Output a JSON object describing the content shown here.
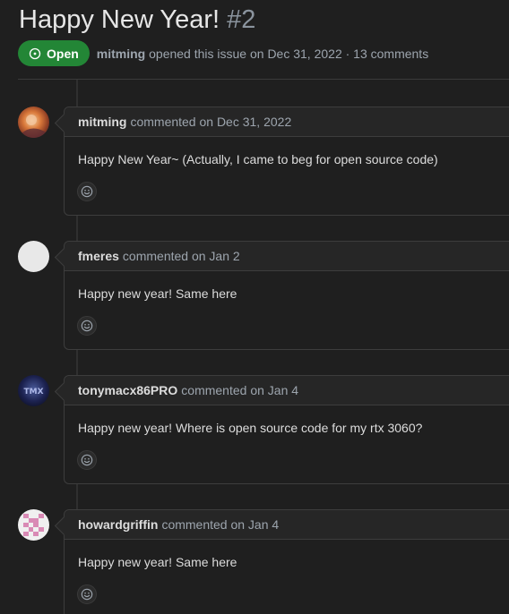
{
  "issue": {
    "title": "Happy New Year!",
    "number": "#2",
    "state": "Open",
    "author": "mitming",
    "opened_text": "opened this issue on Dec 31, 2022 · 13 comments",
    "colors": {
      "open_badge": "#238636"
    }
  },
  "comments": [
    {
      "author": "mitming",
      "action": "commented on Dec 31, 2022",
      "body": "Happy New Year~ (Actually, I came to beg for open source code)",
      "avatar": "orange-portrait-avatar"
    },
    {
      "author": "fmeres",
      "action": "commented on Jan 2",
      "body": "Happy new year! Same here",
      "avatar": "blank-white-avatar"
    },
    {
      "author": "tonymacx86PRO",
      "action": "commented on Jan 4",
      "body": "Happy new year! Where is open source code for my rtx 3060?",
      "avatar": "dark-blue-logo-avatar"
    },
    {
      "author": "howardgriffin",
      "action": "commented on Jan 4",
      "body": "Happy new year! Same here",
      "avatar": "pink-pixel-avatar"
    }
  ],
  "icons": {
    "state": "issue-opened-icon",
    "reaction": "smiley-icon"
  }
}
